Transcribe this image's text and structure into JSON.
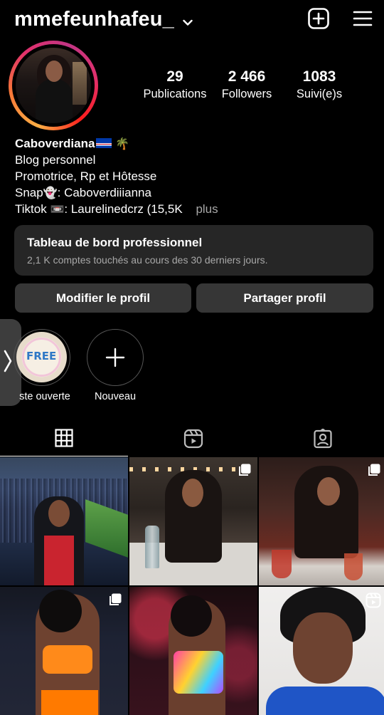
{
  "header": {
    "username": "mmefeunhafeu_",
    "icons": [
      "chevron-down-icon",
      "add-post-icon",
      "menu-icon"
    ]
  },
  "stats": {
    "posts": {
      "value": "29",
      "label": "Publications"
    },
    "followers": {
      "value": "2 466",
      "label": "Followers"
    },
    "following": {
      "value": "1083",
      "label": "Suivi(e)s"
    }
  },
  "bio": {
    "name": "Caboverdiana",
    "name_emojis": "🌴",
    "category": "Blog personnel",
    "line1": "Promotrice, Rp et Hôtesse",
    "snap_label": "Snap",
    "snap_emoji": "👻",
    "snap_value": ": Caboverdiiianna",
    "tiktok_label": "Tiktok",
    "tiktok_emoji": "📼",
    "tiktok_value": ": Laurelinedcrz (15,5K",
    "more": "plus"
  },
  "dashboard": {
    "title": "Tableau de bord professionnel",
    "subtitle": "2,1 K comptes touchés au cours des 30 derniers jours."
  },
  "buttons": {
    "edit": "Modifier le profil",
    "share": "Partager profil"
  },
  "highlights": [
    {
      "label": "ste ouverte",
      "art_text": "FREE"
    },
    {
      "label": "Nouveau"
    }
  ],
  "tabs": [
    "grid-icon",
    "reels-icon",
    "tagged-icon"
  ],
  "posts": [
    {
      "type": "photo"
    },
    {
      "type": "carousel"
    },
    {
      "type": "carousel"
    },
    {
      "type": "carousel"
    },
    {
      "type": "photo"
    },
    {
      "type": "reel"
    }
  ],
  "colors": {
    "background": "#000000",
    "card": "#262626",
    "button": "#363636",
    "muted_text": "#a8a8a8"
  }
}
